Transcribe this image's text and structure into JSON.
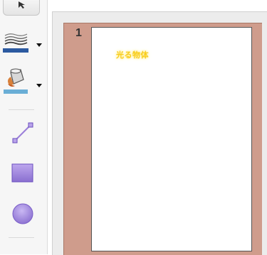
{
  "toolbar": {
    "tools": [
      {
        "name": "line-style",
        "icon": "line-style-icon",
        "has_dropdown": true
      },
      {
        "name": "fill-bucket",
        "icon": "paint-bucket-icon",
        "has_dropdown": true
      },
      {
        "name": "line",
        "icon": "line-tool-icon",
        "has_dropdown": false
      },
      {
        "name": "rectangle",
        "icon": "rectangle-tool-icon",
        "has_dropdown": false
      },
      {
        "name": "ellipse",
        "icon": "ellipse-tool-icon",
        "has_dropdown": false
      }
    ],
    "accent_color": "#9b7fd9",
    "stroke_color": "#2c5aa0"
  },
  "slides": [
    {
      "number": "1",
      "text": "光る物体",
      "text_color": "#f8cd1c",
      "border_color": "#cf9c8c"
    }
  ]
}
